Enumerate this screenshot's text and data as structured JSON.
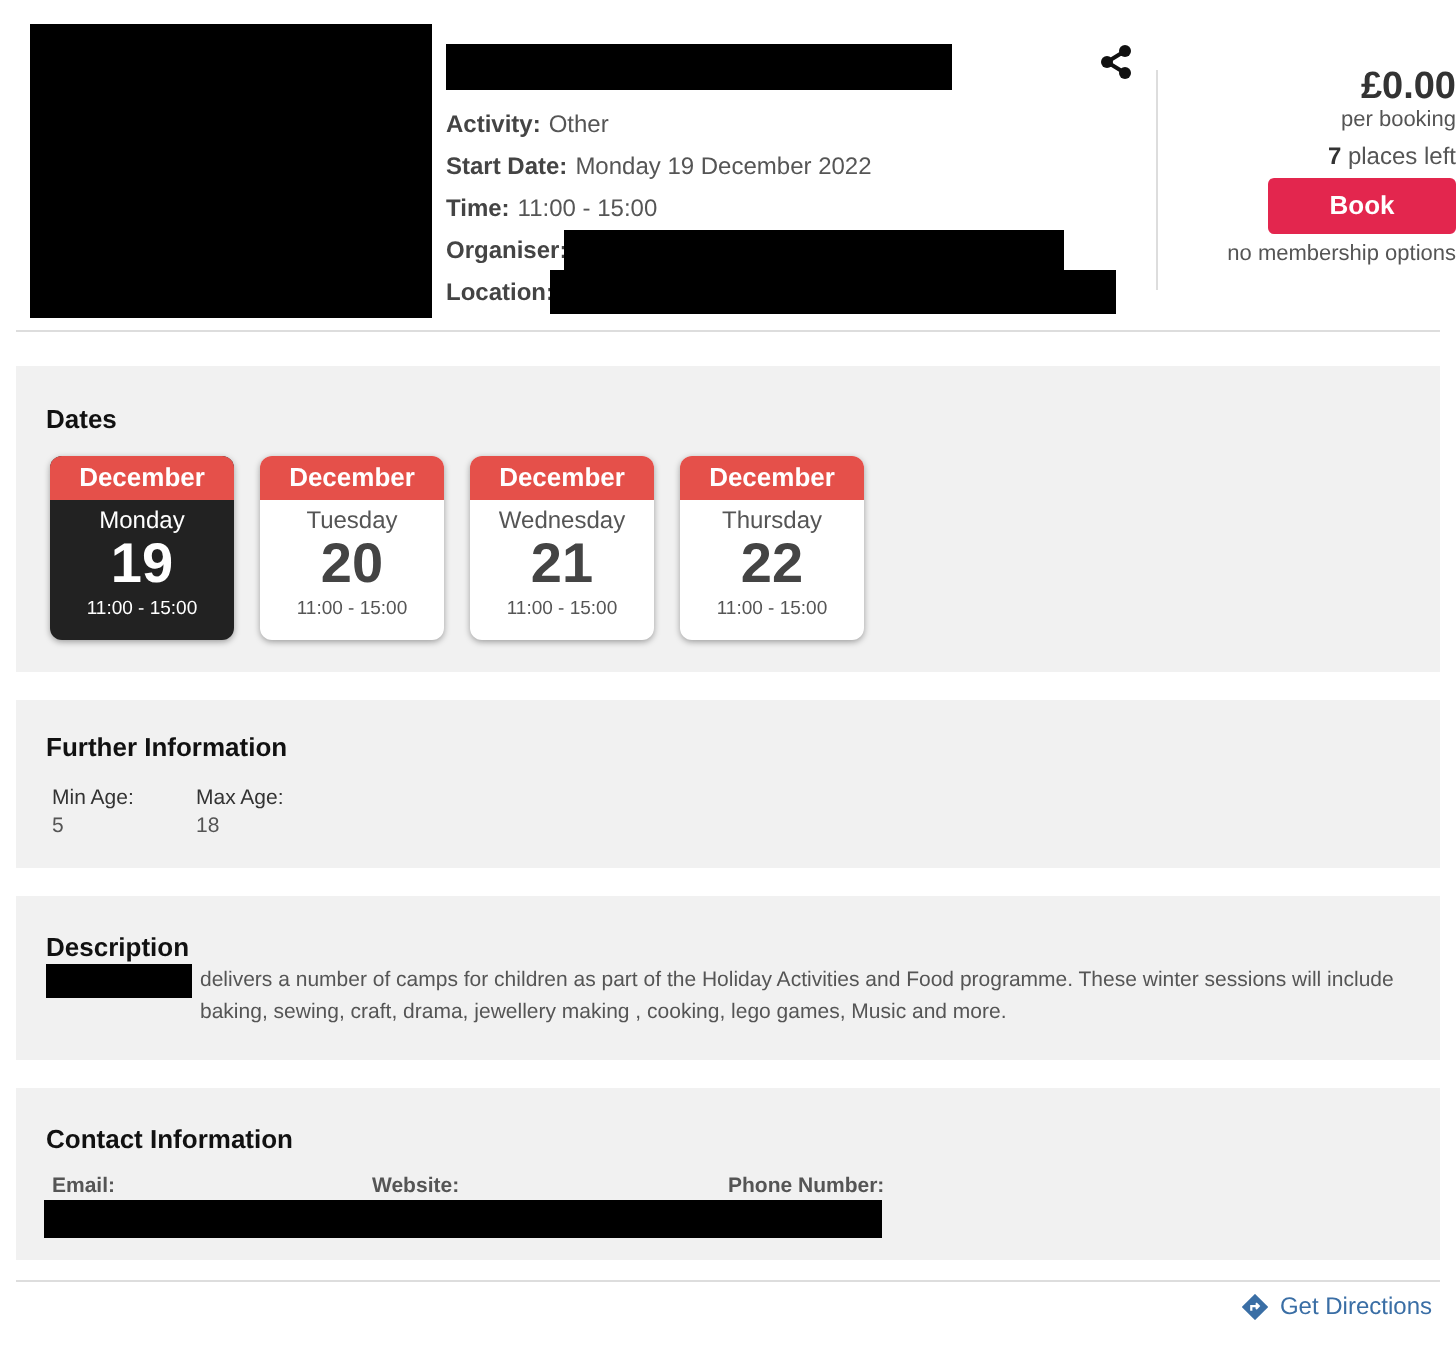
{
  "details": [
    {
      "label": "Activity:",
      "value": "Other"
    },
    {
      "label": "Start Date:",
      "value": "Monday 19 December 2022"
    },
    {
      "label": "Time:",
      "value": "11:00 - 15:00"
    },
    {
      "label": "Organiser:"
    },
    {
      "label": "Location:"
    }
  ],
  "booking": {
    "price": "£0.00",
    "price_note": "per booking",
    "places_count": "7",
    "places_text": "places left",
    "button": "Book",
    "membership_note": "no membership options"
  },
  "dates": {
    "heading": "Dates",
    "items": [
      {
        "month": "December",
        "weekday": "Monday",
        "day": "19",
        "time": "11:00 - 15:00",
        "selected": true
      },
      {
        "month": "December",
        "weekday": "Tuesday",
        "day": "20",
        "time": "11:00 - 15:00",
        "selected": false
      },
      {
        "month": "December",
        "weekday": "Wednesday",
        "day": "21",
        "time": "11:00 - 15:00",
        "selected": false
      },
      {
        "month": "December",
        "weekday": "Thursday",
        "day": "22",
        "time": "11:00 - 15:00",
        "selected": false
      }
    ]
  },
  "further_information": {
    "heading": "Further Information",
    "fields": [
      {
        "label": "Min Age:",
        "value": "5"
      },
      {
        "label": "Max Age:",
        "value": "18"
      }
    ]
  },
  "description": {
    "heading": "Description",
    "text": "delivers a number of camps for children as part of the Holiday Activities and Food programme. These winter sessions will include baking, sewing, craft, drama, jewellery making , cooking, lego games, Music and more."
  },
  "contact": {
    "heading": "Contact Information",
    "labels": [
      "Email:",
      "Website:",
      "Phone Number:"
    ]
  },
  "directions_link": "Get Directions"
}
